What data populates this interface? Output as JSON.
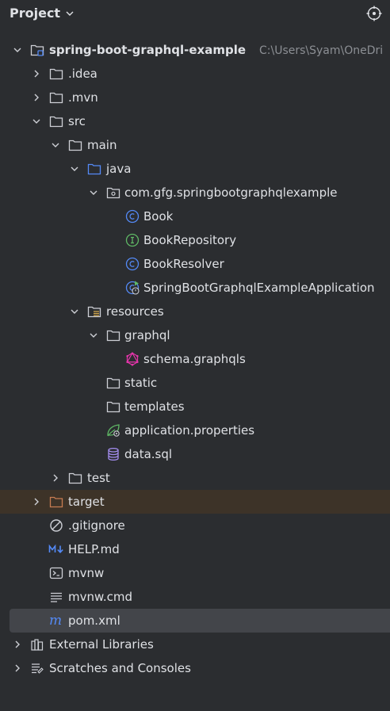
{
  "panel": {
    "title": "Project"
  },
  "colors": {
    "background": "#2b2d30",
    "text": "#dfe1e5",
    "muted_text": "#8c8f94",
    "class_icon": "#548af7",
    "interface_icon": "#5fb865",
    "graphql_icon": "#e535ab",
    "spring_icon": "#5fb865",
    "markdown_icon": "#548af7",
    "pom_icon": "#548af7",
    "excluded_row": "#3d3328",
    "selected_row": "#43454a",
    "excluded_folder": "#c77c52"
  },
  "tree": [
    {
      "label": "spring-boot-graphql-example",
      "path": "C:\\Users\\Syam\\OneDri",
      "icon": "module-folder-icon",
      "expanded": true
    },
    {
      "label": ".idea",
      "icon": "folder-icon",
      "expanded": false
    },
    {
      "label": ".mvn",
      "icon": "folder-icon",
      "expanded": false
    },
    {
      "label": "src",
      "icon": "folder-icon",
      "expanded": true
    },
    {
      "label": "main",
      "icon": "folder-icon",
      "expanded": true
    },
    {
      "label": "java",
      "icon": "source-folder-icon",
      "expanded": true
    },
    {
      "label": "com.gfg.springbootgraphqlexample",
      "icon": "package-icon",
      "expanded": true
    },
    {
      "label": "Book",
      "icon": "class-icon"
    },
    {
      "label": "BookRepository",
      "icon": "interface-icon"
    },
    {
      "label": "BookResolver",
      "icon": "class-icon"
    },
    {
      "label": "SpringBootGraphqlExampleApplication",
      "icon": "spring-boot-class-icon"
    },
    {
      "label": "resources",
      "icon": "resources-folder-icon",
      "expanded": true
    },
    {
      "label": "graphql",
      "icon": "folder-icon",
      "expanded": true
    },
    {
      "label": "schema.graphqls",
      "icon": "graphql-icon"
    },
    {
      "label": "static",
      "icon": "folder-icon"
    },
    {
      "label": "templates",
      "icon": "folder-icon"
    },
    {
      "label": "application.properties",
      "icon": "spring-properties-icon"
    },
    {
      "label": "data.sql",
      "icon": "database-icon"
    },
    {
      "label": "test",
      "icon": "folder-icon",
      "expanded": false
    },
    {
      "label": "target",
      "icon": "excluded-folder-icon",
      "expanded": false
    },
    {
      "label": ".gitignore",
      "icon": "ignore-file-icon"
    },
    {
      "label": "HELP.md",
      "icon": "markdown-icon"
    },
    {
      "label": "mvnw",
      "icon": "shell-script-icon"
    },
    {
      "label": "mvnw.cmd",
      "icon": "text-file-icon"
    },
    {
      "label": "pom.xml",
      "icon": "maven-icon"
    },
    {
      "label": "External Libraries",
      "icon": "libraries-icon",
      "expanded": false
    },
    {
      "label": "Scratches and Consoles",
      "icon": "scratches-icon",
      "expanded": false
    }
  ]
}
